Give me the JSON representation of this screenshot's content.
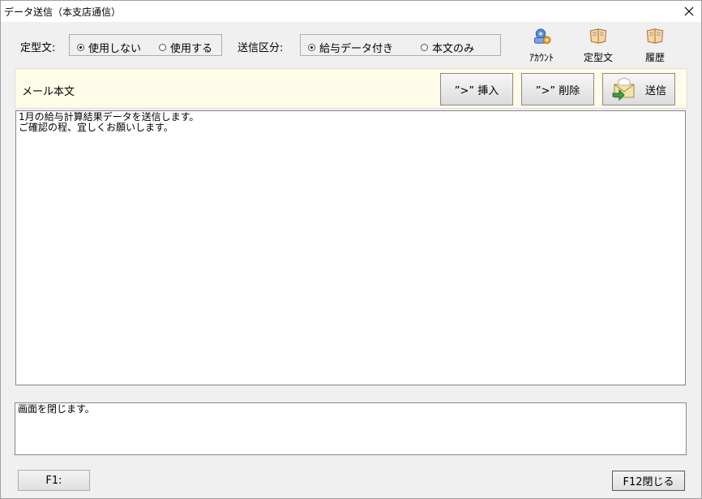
{
  "window": {
    "title": "データ送信（本支店通信）"
  },
  "options": {
    "template_label": "定型文:",
    "template_radio": [
      {
        "label": "使用しない",
        "selected": true
      },
      {
        "label": "使用する",
        "selected": false
      }
    ],
    "send_type_label": "送信区分:",
    "send_type_radio": [
      {
        "label": "給与データ付き",
        "selected": true
      },
      {
        "label": "本文のみ",
        "selected": false
      }
    ]
  },
  "toolbar": {
    "account_label": "ｱｶｳﾝﾄ",
    "template_label": "定型文",
    "history_label": "履歴"
  },
  "mail": {
    "header_label": "メール本文",
    "insert_label": "”>” 挿入",
    "delete_label": "”>” 削除",
    "send_label": "送信",
    "body": "1月の給与計算結果データを送信します。\nご確認の程、宜しくお願いします。"
  },
  "status": {
    "message": "画面を閉じます。"
  },
  "footer": {
    "f1_label": "F1:",
    "f12_label": "F12閉じる"
  },
  "colors": {
    "header_band": "#fffbe9",
    "window_bg": "#f0f0f0"
  }
}
